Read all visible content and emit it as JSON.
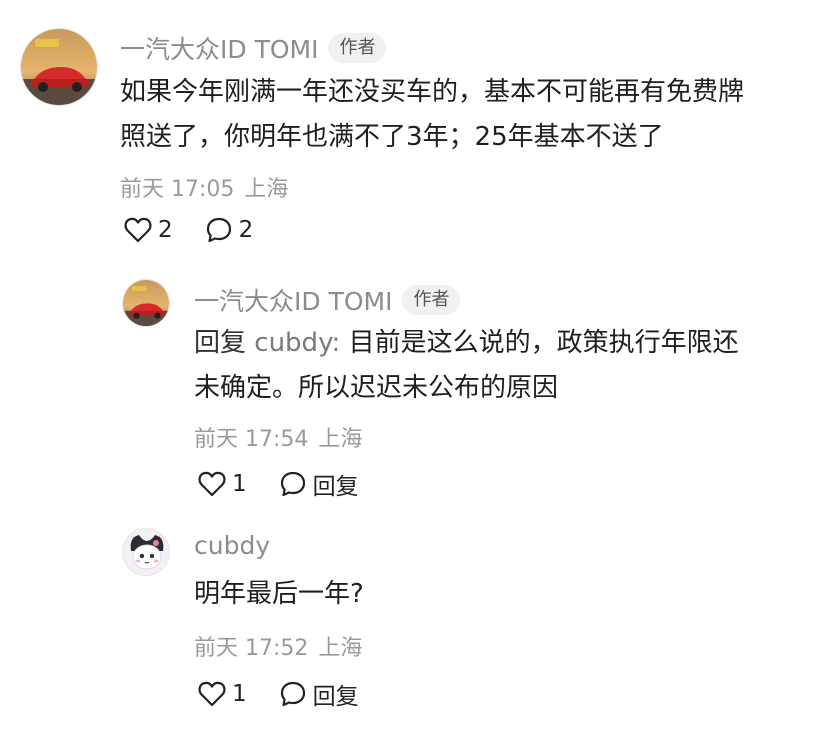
{
  "comments": [
    {
      "username": "一汽大众ID TOMI",
      "badge": "作者",
      "lines": [
        "如果今年刚满一年还没买车的，基本不可能再有免费牌",
        "照送了，你明年也满不了3年；25年基本不送了"
      ],
      "time": "前天 17:05",
      "location": "上海",
      "likes": "2",
      "replies": "2"
    },
    {
      "username": "一汽大众ID TOMI",
      "badge": "作者",
      "reply_prefix": "回复",
      "reply_target": "cubdy:",
      "line1_rest": "目前是这么说的，政策执行年限还",
      "line2": "未确定。所以迟迟未公布的原因",
      "time": "前天 17:54",
      "location": "上海",
      "likes": "1",
      "reply_label": "回复"
    },
    {
      "username": "cubdy",
      "lines": [
        "明年最后一年?"
      ],
      "time": "前天 17:52",
      "location": "上海",
      "likes": "1",
      "reply_label": "回复"
    }
  ],
  "icons": {
    "like": "heart-outline-icon",
    "comment": "speech-bubble-icon"
  },
  "colors": {
    "username": "#8c8c8c",
    "meta": "#9a9a9a",
    "text": "#1f1f1f",
    "badge_bg": "#f1f1f1"
  }
}
